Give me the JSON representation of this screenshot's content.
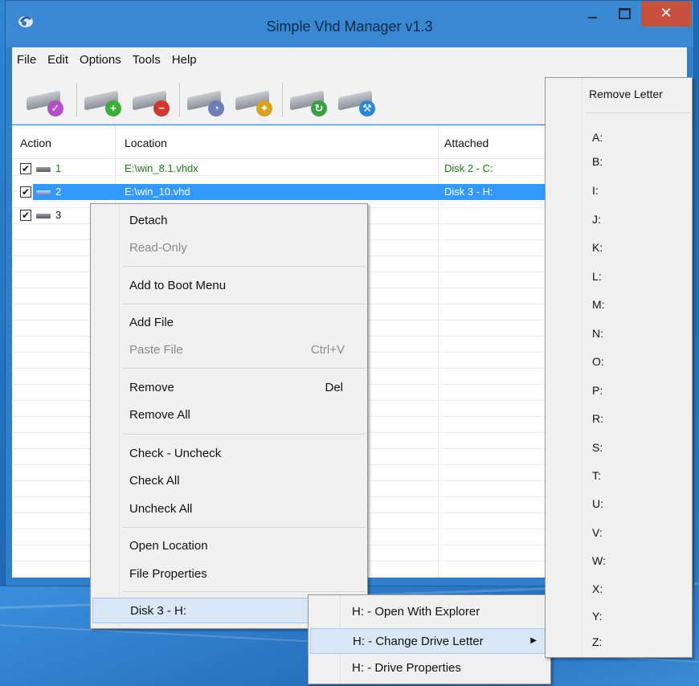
{
  "window": {
    "title": "Simple Vhd Manager v1.3",
    "close_glyph": "✕"
  },
  "menubar": [
    "File",
    "Edit",
    "Options",
    "Tools",
    "Help"
  ],
  "toolbar": [
    {
      "icon": "drive-check-icon",
      "badge": "✓",
      "color": "#b14fc4"
    },
    {
      "icon": "drive-add-icon",
      "badge": "+",
      "color": "#3cae3a"
    },
    {
      "icon": "drive-remove-icon",
      "badge": "−",
      "color": "#d2362d"
    },
    {
      "icon": "drive-mount-icon",
      "badge": "◔",
      "color": "#6b7cb8"
    },
    {
      "icon": "drive-magic-icon",
      "badge": "✦",
      "color": "#d8a41f"
    },
    {
      "icon": "drive-refresh-icon",
      "badge": "↻",
      "color": "#38a043"
    },
    {
      "icon": "drive-settings-icon",
      "badge": "⚒",
      "color": "#2a86d6"
    }
  ],
  "listview": {
    "columns": [
      "Action",
      "Location",
      "Attached"
    ],
    "rows": [
      {
        "check": "✔",
        "num": "1",
        "location": "E:\\win_8.1.vhdx",
        "attached": "Disk 2  -  C:"
      },
      {
        "check": "✔",
        "num": "2",
        "location": "E:\\win_10.vhd",
        "attached": "Disk 3  -  H:"
      },
      {
        "check": "✔",
        "num": "3",
        "location": "",
        "attached": ""
      }
    ]
  },
  "context_menu": {
    "detach": "Detach",
    "read_only": "Read-Only",
    "add_boot": "Add to Boot Menu",
    "add_file": "Add File",
    "paste_file": "Paste File",
    "paste_shortcut": "Ctrl+V",
    "remove": "Remove",
    "remove_shortcut": "Del",
    "remove_all": "Remove All",
    "check_uncheck": "Check - Uncheck",
    "check_all": "Check All",
    "uncheck_all": "Uncheck All",
    "open_location": "Open Location",
    "file_properties": "File Properties",
    "disk": "Disk 3  -  H:"
  },
  "disk_submenu": {
    "open_explorer": "H: - Open With Explorer",
    "change_letter": "H: - Change Drive Letter",
    "drive_properties": "H: - Drive Properties"
  },
  "letter_submenu": {
    "remove": "Remove Letter",
    "letters": [
      "A:",
      "B:",
      "I:",
      "J:",
      "K:",
      "L:",
      "M:",
      "N:",
      "O:",
      "P:",
      "R:",
      "S:",
      "T:",
      "U:",
      "V:",
      "W:",
      "X:",
      "Y:",
      "Z:"
    ]
  },
  "arrow_glyph": "▶"
}
